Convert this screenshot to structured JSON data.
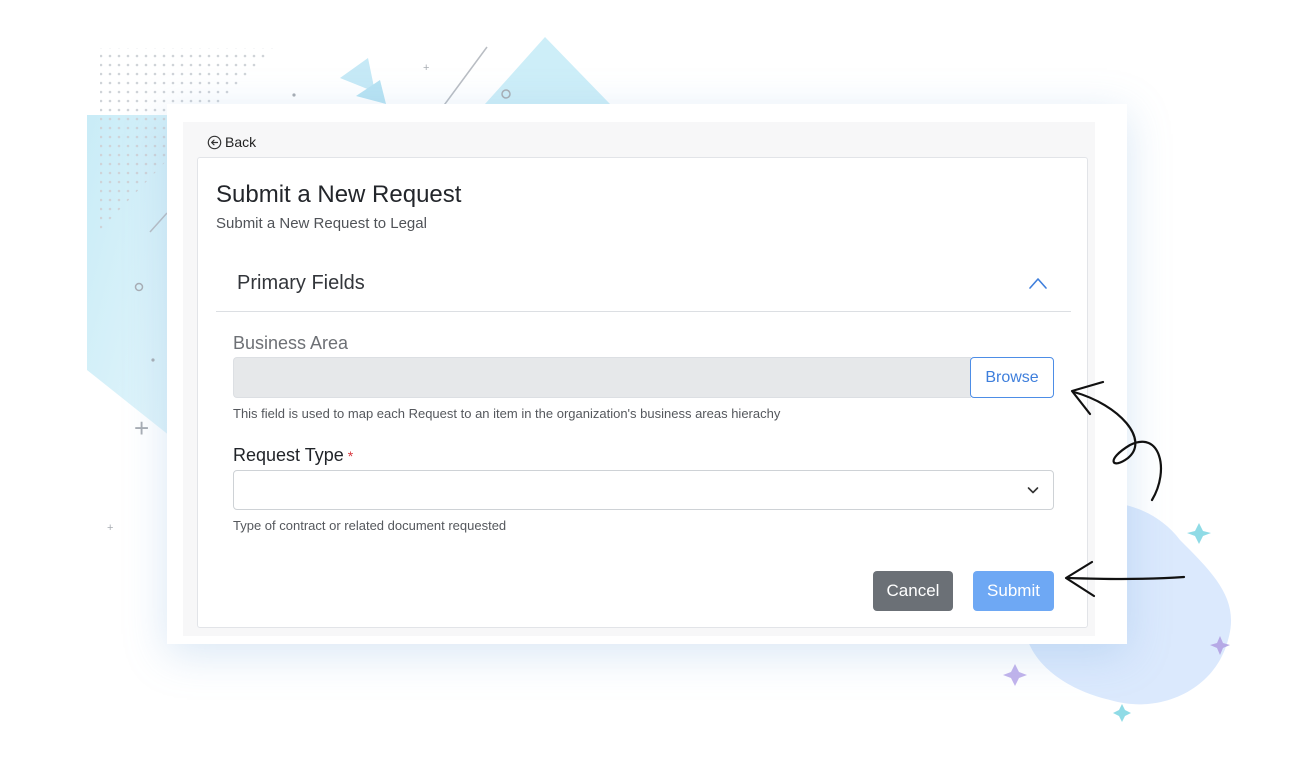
{
  "nav": {
    "back_label": "Back"
  },
  "header": {
    "title": "Submit a New Request",
    "subtitle": "Submit a New Request to Legal"
  },
  "section": {
    "title": "Primary Fields",
    "expanded": true
  },
  "fields": {
    "business_area": {
      "label": "Business Area",
      "value": "",
      "browse_label": "Browse",
      "help": "This field is used to map each Request to an item in the organization's business areas hierachy"
    },
    "request_type": {
      "label": "Request Type",
      "required_marker": "*",
      "selected": "",
      "help": "Type of contract or related document requested"
    }
  },
  "actions": {
    "cancel_label": "Cancel",
    "submit_label": "Submit"
  },
  "icons": [
    "back-arrow-circle-icon",
    "chevron-up-icon",
    "chevron-down-icon"
  ],
  "colors": {
    "primary": "#4d8de6",
    "submit": "#6ea8f4",
    "cancel": "#6b7076",
    "required": "#d8383f"
  }
}
